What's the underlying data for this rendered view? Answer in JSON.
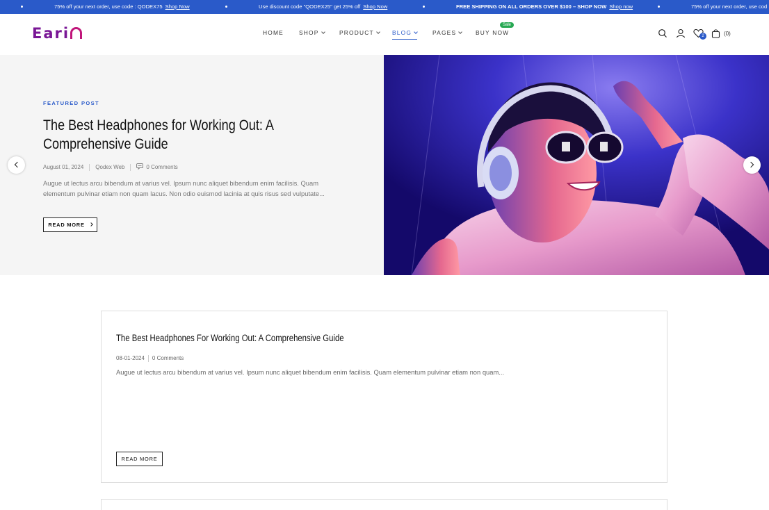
{
  "announcements": [
    {
      "text": "75% off your next order, use code : QODEX75",
      "link": "Shop Now",
      "bold": false
    },
    {
      "text": "Use discount code \"QODEX25\" get 25% off",
      "link": "Shop Now",
      "bold": false
    },
    {
      "text": "FREE SHIPPING ON ALL ORDERS OVER $100 – SHOP NOW",
      "link": "Shop now",
      "bold": true
    },
    {
      "text": "75% off your next order, use cod",
      "link": "",
      "bold": false
    }
  ],
  "header": {
    "logo": "Eari",
    "nav": {
      "home": "HOME",
      "shop": "SHOP",
      "product": "PRODUCT",
      "blog": "BLOG",
      "pages": "PAGES",
      "buy_now": "BUY NOW",
      "sale_badge": "Sale"
    },
    "wishlist_count": "2",
    "cart_count": "(0)",
    "icons": [
      "search-icon",
      "user-icon",
      "heart-icon",
      "bag-icon"
    ]
  },
  "hero": {
    "label": "FEATURED POST",
    "title": "The Best Headphones for Working Out: A Comprehensive Guide",
    "date": "August 01, 2024",
    "author": "Qodex Web",
    "comments": "0 Comments",
    "excerpt": "Augue ut lectus arcu bibendum at varius vel. Ipsum nunc aliquet bibendum enim facilisis. Quam elementum pulvinar etiam non quam lacus. Non odio euismod lacinia at quis risus sed vulputate...",
    "button": "READ MORE"
  },
  "post": {
    "title": "The Best Headphones For Working Out: A Comprehensive Guide",
    "date": "08-01-2024",
    "comments": "0 Comments",
    "excerpt": "Augue ut lectus arcu bibendum at varius vel. Ipsum nunc aliquet bibendum enim facilisis. Quam elementum pulvinar etiam non quam...",
    "button": "READ MORE"
  },
  "colors": {
    "accent": "#2a5ac9",
    "brand": "#7a1796",
    "sale": "#27a852"
  }
}
